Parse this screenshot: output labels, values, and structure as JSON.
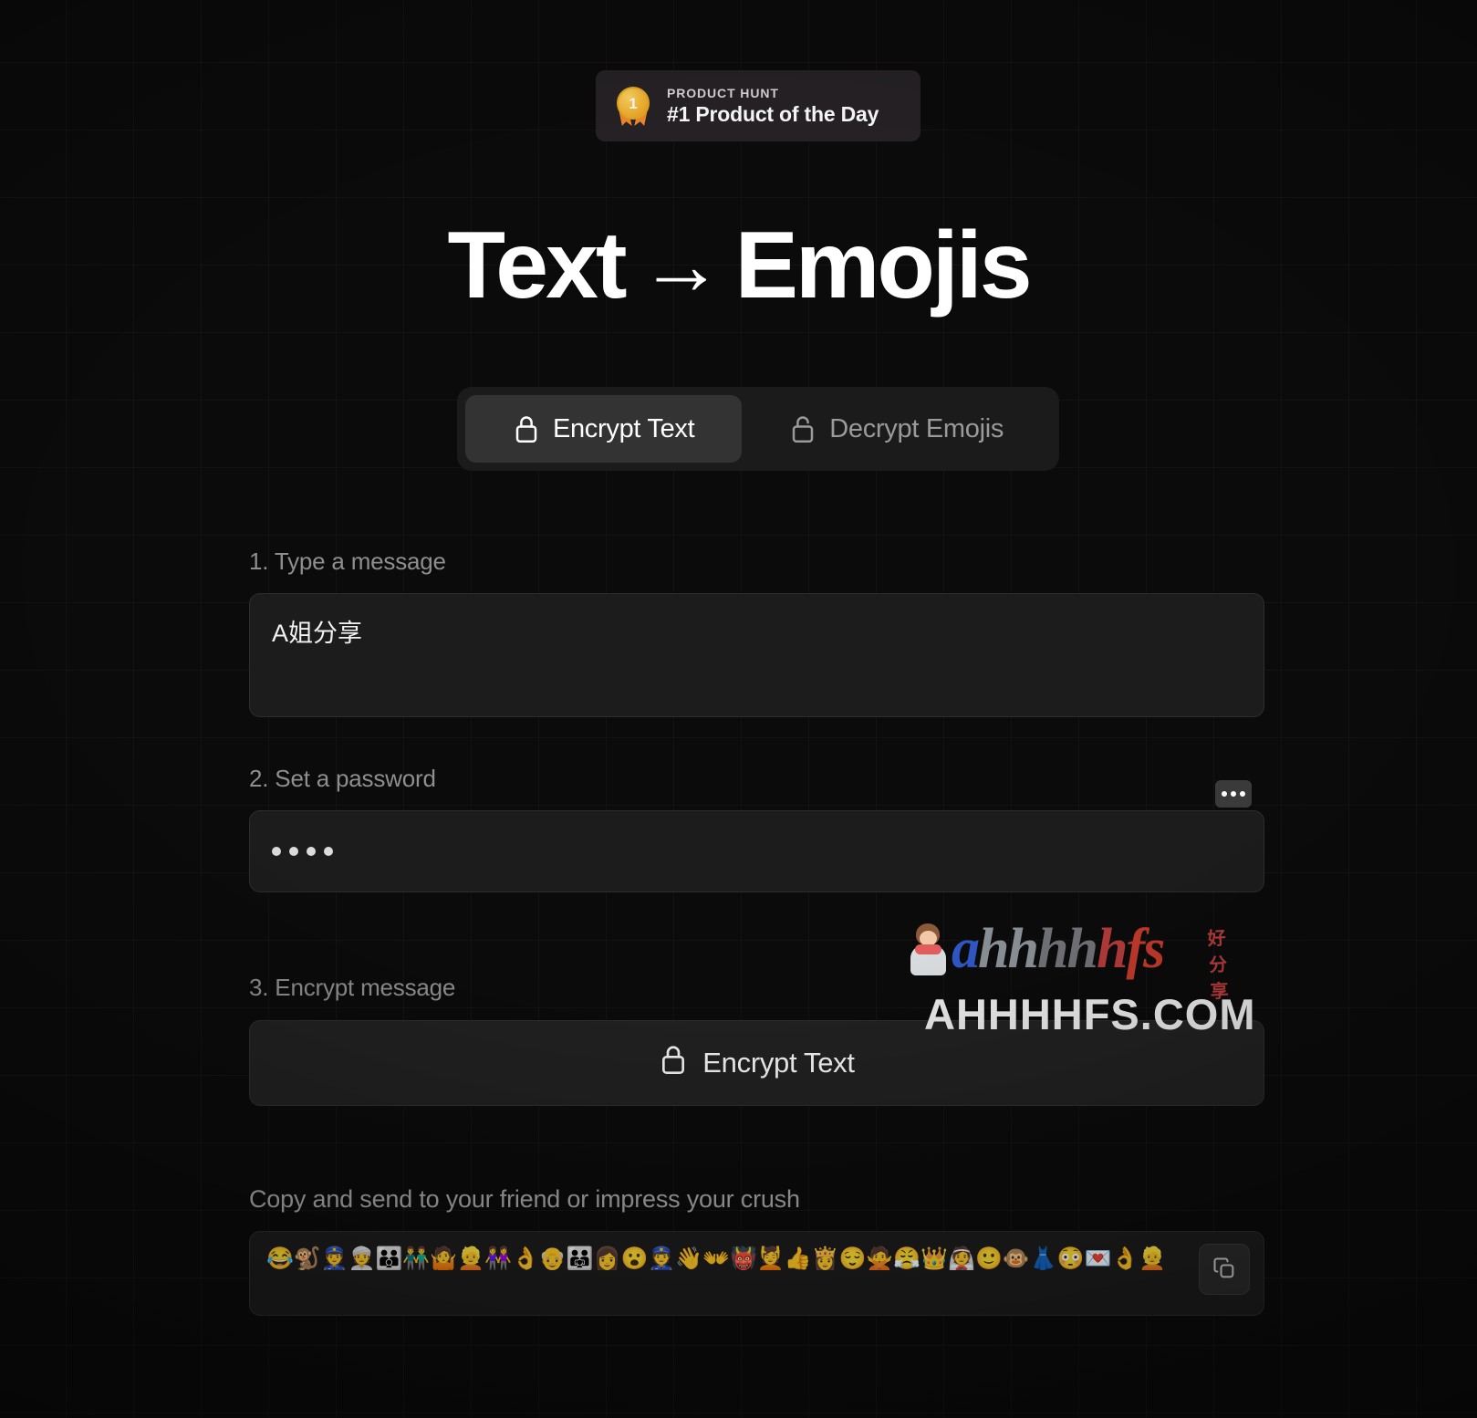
{
  "badge": {
    "kicker": "PRODUCT HUNT",
    "title": "#1 Product of the Day",
    "medal_rank": "1"
  },
  "heading": {
    "left": "Text",
    "arrow": "→",
    "right": "Emojis"
  },
  "tabs": [
    {
      "label": "Encrypt Text",
      "icon": "lock-closed-icon",
      "active": true
    },
    {
      "label": "Decrypt Emojis",
      "icon": "lock-open-icon",
      "active": false
    }
  ],
  "steps": {
    "message_label": "1. Type a message",
    "message_value": "A姐分享",
    "message_placeholder": "Type a message",
    "password_label": "2. Set a password",
    "password_value": "••••",
    "password_dots": 4,
    "password_placeholder": "Set a password",
    "password_toggle_icon": "show-password-dots-icon",
    "encrypt_label": "3. Encrypt message",
    "encrypt_button": "Encrypt Text",
    "encrypt_button_icon": "lock-closed-icon"
  },
  "output": {
    "label": "Copy and send to your friend or impress your crush",
    "value": "😂🐒👮👳👪👬🤷👱👭👌👴👨‍👨‍👧👩😮👮👋👐👹💆👍👸😌🙅😤👑👰🙂🐵👗😳💌👌👱",
    "copy_icon": "copy-icon"
  },
  "watermark": {
    "brand_letters": [
      "a",
      "h",
      "h",
      "h",
      "h",
      "h",
      "f",
      "s"
    ],
    "cjk": "好分享",
    "domain": "AHHHHFS.COM"
  },
  "colors": {
    "background": "#0b0b0b",
    "panel": "#1c1c1c",
    "tab_active": "#333333",
    "accent_gold": "#f2b230",
    "text_primary": "#ffffff",
    "text_muted": "#8e8e8e"
  }
}
